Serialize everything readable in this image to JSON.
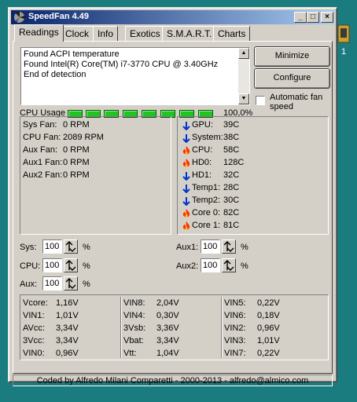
{
  "window": {
    "title": "SpeedFan 4.49"
  },
  "titlebar_buttons": {
    "minimize": "_",
    "maximize": "□",
    "close": "×"
  },
  "tabs": [
    {
      "label": "Readings"
    },
    {
      "label": "Clock"
    },
    {
      "label": "Info"
    },
    {
      "label": "Exotics"
    },
    {
      "label": "S.M.A.R.T."
    },
    {
      "label": "Charts"
    }
  ],
  "log": [
    "Found ACPI temperature",
    "Found Intel(R) Core(TM) i7-3770 CPU @ 3.40GHz",
    "End of detection"
  ],
  "buttons": {
    "minimize": "Minimize",
    "configure": "Configure"
  },
  "auto_fan": {
    "label": "Automatic fan speed",
    "checked": false
  },
  "cpu_usage": {
    "label": "CPU Usage",
    "value": "100,0%",
    "bars": 8
  },
  "fans": [
    {
      "label": "Sys Fan:",
      "value": "0 RPM"
    },
    {
      "label": "CPU Fan:",
      "value": "2089 RPM"
    },
    {
      "label": "Aux Fan:",
      "value": "0 RPM"
    },
    {
      "label": "Aux1 Fan:",
      "value": "0 RPM"
    },
    {
      "label": "Aux2 Fan:",
      "value": "0 RPM"
    }
  ],
  "temps": [
    {
      "label": "GPU:",
      "value": "39C",
      "trend": "down"
    },
    {
      "label": "System:",
      "value": "38C",
      "trend": "down"
    },
    {
      "label": "CPU:",
      "value": "58C",
      "trend": "hot"
    },
    {
      "label": "HD0:",
      "value": "128C",
      "trend": "hot"
    },
    {
      "label": "HD1:",
      "value": "32C",
      "trend": "down"
    },
    {
      "label": "Temp1:",
      "value": "28C",
      "trend": "down"
    },
    {
      "label": "Temp2:",
      "value": "30C",
      "trend": "down"
    },
    {
      "label": "Core 0:",
      "value": "82C",
      "trend": "hot"
    },
    {
      "label": "Core 1:",
      "value": "81C",
      "trend": "hot"
    }
  ],
  "speeds": [
    {
      "label": "Sys:",
      "value": "100",
      "unit": "%"
    },
    {
      "label": "CPU:",
      "value": "100",
      "unit": "%"
    },
    {
      "label": "Aux:",
      "value": "100",
      "unit": "%"
    },
    {
      "label": "Aux1:",
      "value": "100",
      "unit": "%"
    },
    {
      "label": "Aux2:",
      "value": "100",
      "unit": "%"
    }
  ],
  "voltages": [
    [
      {
        "label": "Vcore:",
        "value": "1,16V"
      },
      {
        "label": "VIN1:",
        "value": "1,01V"
      },
      {
        "label": "AVcc:",
        "value": "3,34V"
      },
      {
        "label": "3Vcc:",
        "value": "3,34V"
      },
      {
        "label": "VIN0:",
        "value": "0,96V"
      }
    ],
    [
      {
        "label": "VIN8:",
        "value": "2,04V"
      },
      {
        "label": "VIN4:",
        "value": "0,30V"
      },
      {
        "label": "3Vsb:",
        "value": "3,36V"
      },
      {
        "label": "Vbat:",
        "value": "3,34V"
      },
      {
        "label": "Vtt:",
        "value": "1,04V"
      }
    ],
    [
      {
        "label": "VIN5:",
        "value": "0,22V"
      },
      {
        "label": "VIN6:",
        "value": "0,18V"
      },
      {
        "label": "VIN2:",
        "value": "0,96V"
      },
      {
        "label": "VIN3:",
        "value": "1,01V"
      },
      {
        "label": "VIN7:",
        "value": "0,22V"
      }
    ]
  ],
  "status": "Coded by Alfredo Milani Comparetti - 2000-2013 - alfredo@almico.com",
  "desktop": {
    "icon_label": "1"
  },
  "colors": {
    "desktop": "#1b7c80",
    "title_start": "#0a246a",
    "title_end": "#a6caf0",
    "led": "#22c422",
    "arrow_blue": "#0033cc",
    "flame": "#ff3300"
  }
}
